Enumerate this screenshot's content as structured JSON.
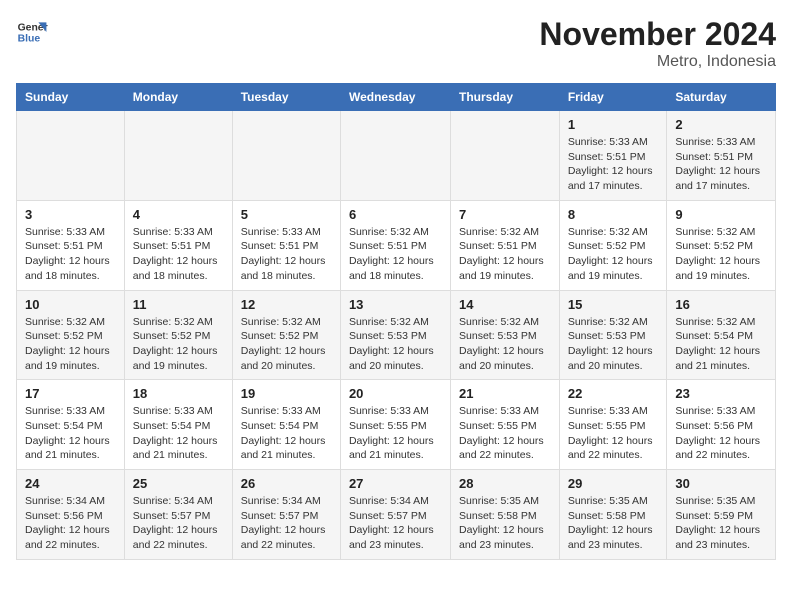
{
  "header": {
    "logo_line1": "General",
    "logo_line2": "Blue",
    "title": "November 2024",
    "subtitle": "Metro, Indonesia"
  },
  "days_of_week": [
    "Sunday",
    "Monday",
    "Tuesday",
    "Wednesday",
    "Thursday",
    "Friday",
    "Saturday"
  ],
  "weeks": [
    {
      "days": [
        {
          "date": "",
          "info": ""
        },
        {
          "date": "",
          "info": ""
        },
        {
          "date": "",
          "info": ""
        },
        {
          "date": "",
          "info": ""
        },
        {
          "date": "",
          "info": ""
        },
        {
          "date": "1",
          "info": "Sunrise: 5:33 AM\nSunset: 5:51 PM\nDaylight: 12 hours and 17 minutes."
        },
        {
          "date": "2",
          "info": "Sunrise: 5:33 AM\nSunset: 5:51 PM\nDaylight: 12 hours and 17 minutes."
        }
      ]
    },
    {
      "days": [
        {
          "date": "3",
          "info": "Sunrise: 5:33 AM\nSunset: 5:51 PM\nDaylight: 12 hours and 18 minutes."
        },
        {
          "date": "4",
          "info": "Sunrise: 5:33 AM\nSunset: 5:51 PM\nDaylight: 12 hours and 18 minutes."
        },
        {
          "date": "5",
          "info": "Sunrise: 5:33 AM\nSunset: 5:51 PM\nDaylight: 12 hours and 18 minutes."
        },
        {
          "date": "6",
          "info": "Sunrise: 5:32 AM\nSunset: 5:51 PM\nDaylight: 12 hours and 18 minutes."
        },
        {
          "date": "7",
          "info": "Sunrise: 5:32 AM\nSunset: 5:51 PM\nDaylight: 12 hours and 19 minutes."
        },
        {
          "date": "8",
          "info": "Sunrise: 5:32 AM\nSunset: 5:52 PM\nDaylight: 12 hours and 19 minutes."
        },
        {
          "date": "9",
          "info": "Sunrise: 5:32 AM\nSunset: 5:52 PM\nDaylight: 12 hours and 19 minutes."
        }
      ]
    },
    {
      "days": [
        {
          "date": "10",
          "info": "Sunrise: 5:32 AM\nSunset: 5:52 PM\nDaylight: 12 hours and 19 minutes."
        },
        {
          "date": "11",
          "info": "Sunrise: 5:32 AM\nSunset: 5:52 PM\nDaylight: 12 hours and 19 minutes."
        },
        {
          "date": "12",
          "info": "Sunrise: 5:32 AM\nSunset: 5:52 PM\nDaylight: 12 hours and 20 minutes."
        },
        {
          "date": "13",
          "info": "Sunrise: 5:32 AM\nSunset: 5:53 PM\nDaylight: 12 hours and 20 minutes."
        },
        {
          "date": "14",
          "info": "Sunrise: 5:32 AM\nSunset: 5:53 PM\nDaylight: 12 hours and 20 minutes."
        },
        {
          "date": "15",
          "info": "Sunrise: 5:32 AM\nSunset: 5:53 PM\nDaylight: 12 hours and 20 minutes."
        },
        {
          "date": "16",
          "info": "Sunrise: 5:32 AM\nSunset: 5:54 PM\nDaylight: 12 hours and 21 minutes."
        }
      ]
    },
    {
      "days": [
        {
          "date": "17",
          "info": "Sunrise: 5:33 AM\nSunset: 5:54 PM\nDaylight: 12 hours and 21 minutes."
        },
        {
          "date": "18",
          "info": "Sunrise: 5:33 AM\nSunset: 5:54 PM\nDaylight: 12 hours and 21 minutes."
        },
        {
          "date": "19",
          "info": "Sunrise: 5:33 AM\nSunset: 5:54 PM\nDaylight: 12 hours and 21 minutes."
        },
        {
          "date": "20",
          "info": "Sunrise: 5:33 AM\nSunset: 5:55 PM\nDaylight: 12 hours and 21 minutes."
        },
        {
          "date": "21",
          "info": "Sunrise: 5:33 AM\nSunset: 5:55 PM\nDaylight: 12 hours and 22 minutes."
        },
        {
          "date": "22",
          "info": "Sunrise: 5:33 AM\nSunset: 5:55 PM\nDaylight: 12 hours and 22 minutes."
        },
        {
          "date": "23",
          "info": "Sunrise: 5:33 AM\nSunset: 5:56 PM\nDaylight: 12 hours and 22 minutes."
        }
      ]
    },
    {
      "days": [
        {
          "date": "24",
          "info": "Sunrise: 5:34 AM\nSunset: 5:56 PM\nDaylight: 12 hours and 22 minutes."
        },
        {
          "date": "25",
          "info": "Sunrise: 5:34 AM\nSunset: 5:57 PM\nDaylight: 12 hours and 22 minutes."
        },
        {
          "date": "26",
          "info": "Sunrise: 5:34 AM\nSunset: 5:57 PM\nDaylight: 12 hours and 22 minutes."
        },
        {
          "date": "27",
          "info": "Sunrise: 5:34 AM\nSunset: 5:57 PM\nDaylight: 12 hours and 23 minutes."
        },
        {
          "date": "28",
          "info": "Sunrise: 5:35 AM\nSunset: 5:58 PM\nDaylight: 12 hours and 23 minutes."
        },
        {
          "date": "29",
          "info": "Sunrise: 5:35 AM\nSunset: 5:58 PM\nDaylight: 12 hours and 23 minutes."
        },
        {
          "date": "30",
          "info": "Sunrise: 5:35 AM\nSunset: 5:59 PM\nDaylight: 12 hours and 23 minutes."
        }
      ]
    }
  ]
}
